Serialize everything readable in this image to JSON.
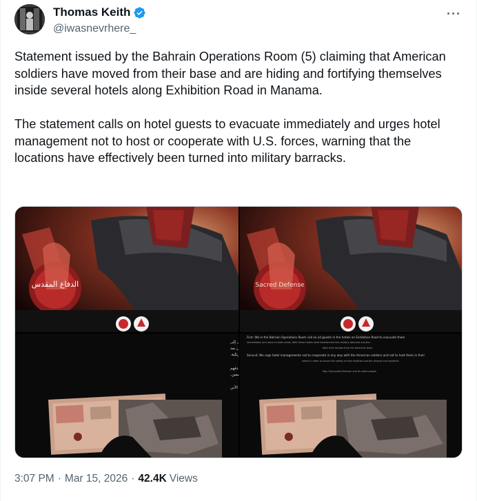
{
  "author": {
    "display_name": "Thomas Keith",
    "handle": "@iwasnevrhere_",
    "verified": true
  },
  "menu": {
    "more_label": "···"
  },
  "tweet": {
    "paragraphs": [
      "Statement issued by the Bahrain Operations Room (5) claiming that American soldiers have moved from their base and are hiding and fortifying themselves inside several hotels along Exhibition Road in Manama.",
      "The statement calls on hotel guests to evacuate immediately and urges hotel management not to host or cooperate with U.S. forces, warning that the locations have effectively been turned into military barracks."
    ]
  },
  "media": {
    "image1_caption_ar": "الدفاع المقدس",
    "image2_caption_en": "Sacred Defense",
    "image3_lines": [
      "أولاً: ندعو في غرفة عمليات البحرين جميع النزلاء في فنادق شارع المعارض إلى إخلائها فوراً والانتقال إلى",
      "مناطق أكثر أماناً، بعد أن تحولت هذه الفنادق إلى ثكنات عسكرية وتجمعات لجنود وضباط أمريكان بعد",
      "فرارهم من القاعدة الأمريكية.",
      "ثانياً: نحث إدارات الفنادق على عدم التعاون بتاتاً مع الجنود الأمريكيين وعدم استضافتهم في فنادقهم",
      "حرصاً على سلامة منشآتهم والمواطنين والمقيمين.",
      "حمى الله البحرين وشعبها الأبي"
    ],
    "image4_lines": [
      "First: We in the Bahrain Operations Room call on all guests in the hotels on Exhibition Road to evacuate them",
      "immediately and move to safer areas, after these hotels were transformed into military barracks and the...",
      "after their escape from the American base",
      "Second: We urge hotel managements not to cooperate in any way with the American soldiers and not to host them in their",
      "hotels in order to ensure the safety of their facilities and the citizens and residents",
      "May God protect Bahrain and its noble people"
    ]
  },
  "meta": {
    "time": "3:07 PM",
    "date": "Mar 15, 2026",
    "separator": "·",
    "views_count": "42.4K",
    "views_label": "Views"
  },
  "colors": {
    "text_primary": "#0f1419",
    "text_secondary": "#536471",
    "verified_blue": "#1d9bf0",
    "accent_red": "#c8282d"
  }
}
